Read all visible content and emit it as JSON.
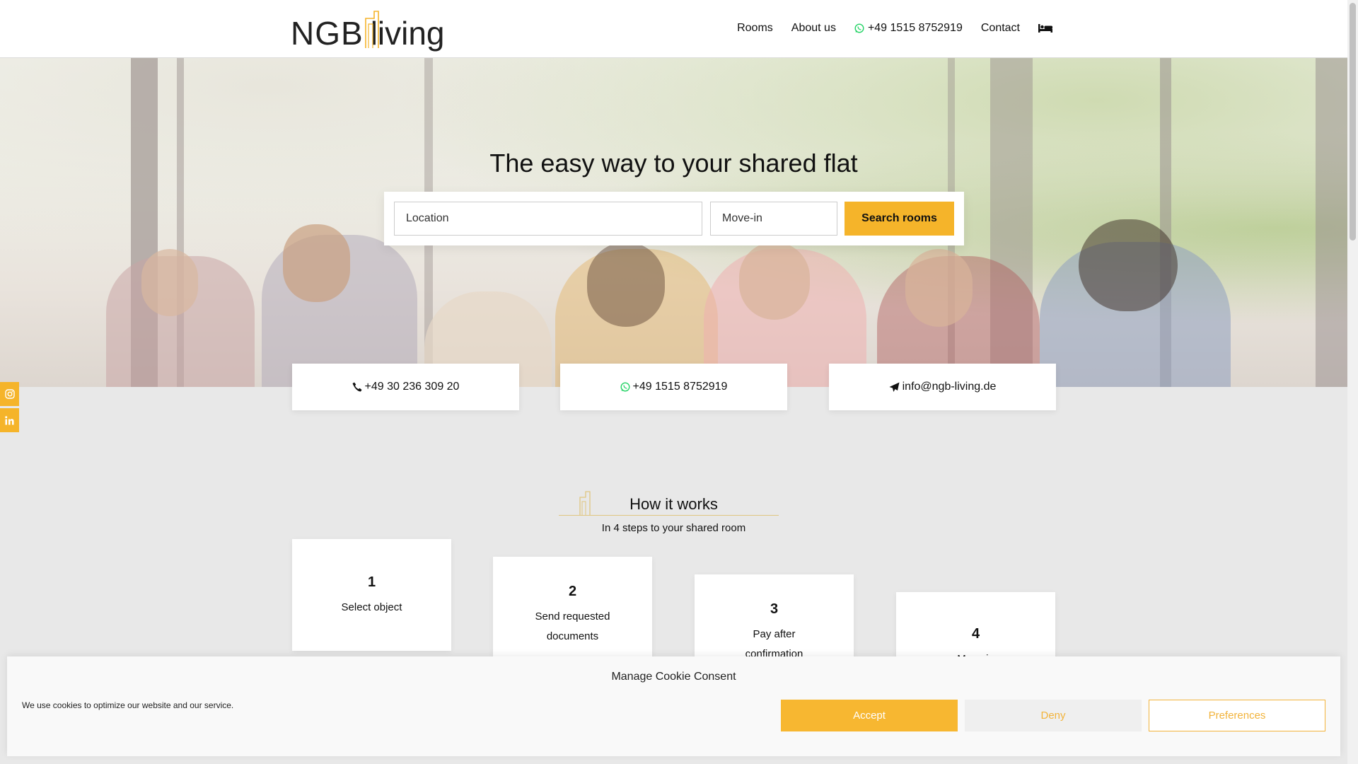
{
  "brand": {
    "logo_ngb": "NGB",
    "logo_living": "living",
    "accent": "#f5b42a"
  },
  "nav": {
    "items": [
      {
        "label": "Rooms"
      },
      {
        "label": "About us"
      },
      {
        "label": "+49 1515 8752919",
        "icon": "whatsapp-icon"
      },
      {
        "label": "Contact"
      }
    ],
    "bed_icon": "bed-icon"
  },
  "hero": {
    "title": "The easy way to your shared flat",
    "search": {
      "location_placeholder": "Location",
      "movein_placeholder": "Move-in",
      "button_label": "Search rooms"
    }
  },
  "contacts": [
    {
      "label": "+49 30 236 309 20",
      "icon": "phone-icon"
    },
    {
      "label": "+49 1515 8752919",
      "icon": "whatsapp-icon"
    },
    {
      "label": "info@ngb-living.de",
      "icon": "paper-plane-icon"
    }
  ],
  "social": [
    {
      "icon": "instagram-icon"
    },
    {
      "icon": "linkedin-icon"
    }
  ],
  "how_it_works": {
    "title": "How it works",
    "subtitle": "In 4 steps to your shared room",
    "steps": [
      {
        "number": "1",
        "text": "Select object"
      },
      {
        "number": "2",
        "text": "Send requested documents"
      },
      {
        "number": "3",
        "text": "Pay after confirmation"
      },
      {
        "number": "4",
        "text": "Move in"
      }
    ]
  },
  "cookie": {
    "title": "Manage Cookie Consent",
    "text": "We use cookies to optimize our website and our service.",
    "accept": "Accept",
    "deny": "Deny",
    "preferences": "Preferences"
  }
}
